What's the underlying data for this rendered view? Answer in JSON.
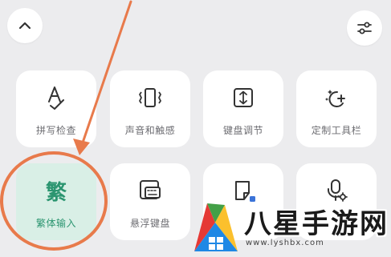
{
  "toolbar": {
    "collapse_icon": "chevron-up-icon",
    "settings_icon": "sliders-icon"
  },
  "tiles": [
    {
      "label": "拼写检查",
      "icon": "spell-check-icon"
    },
    {
      "label": "声音和触感",
      "icon": "vibration-icon"
    },
    {
      "label": "键盘调节",
      "icon": "keyboard-resize-icon"
    },
    {
      "label": "定制工具栏",
      "icon": "customize-toolbar-icon"
    },
    {
      "label": "繁体输入",
      "glyph": "繁",
      "icon": "traditional-chinese-icon",
      "active": true
    },
    {
      "label": "悬浮键盘",
      "icon": "floating-keyboard-icon"
    },
    {
      "label": "",
      "icon": "clipboard-icon"
    },
    {
      "label": "",
      "icon": "voice-settings-icon"
    }
  ],
  "watermark": {
    "title": "八星手游网",
    "url": "www.lyshbx.com"
  },
  "colors": {
    "accent_green": "#2b9570",
    "highlight_orange": "#e87a4b",
    "tile_bg": "#ffffff",
    "page_bg": "#ececee"
  }
}
